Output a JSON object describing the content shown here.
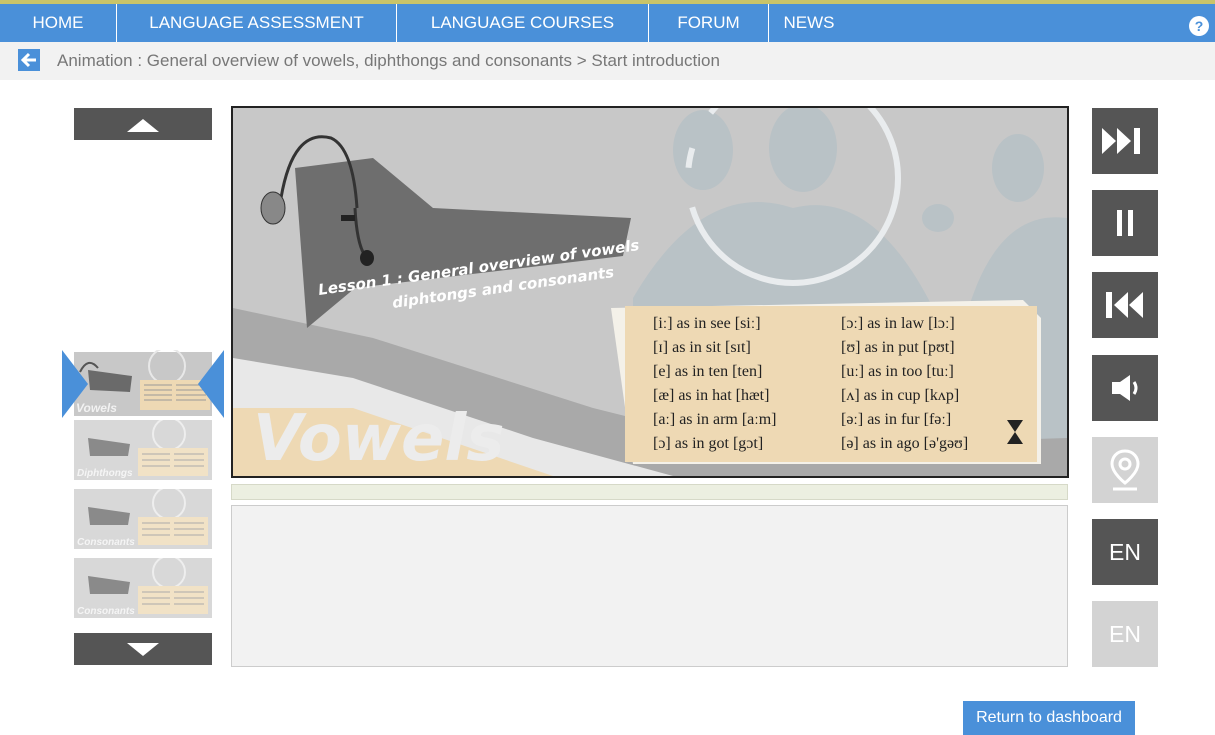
{
  "nav": {
    "items": [
      "HOME",
      "LANGUAGE ASSESSMENT",
      "LANGUAGE COURSES",
      "FORUM",
      "NEWS"
    ],
    "help_label": "?"
  },
  "breadcrumb": {
    "text": "Animation : General overview of vowels, diphthongs and consonants > Start introduction"
  },
  "thumbnails": [
    {
      "label": "Vowels",
      "active": true
    },
    {
      "label": "Diphthongs",
      "active": false
    },
    {
      "label": "Consonants",
      "active": false
    },
    {
      "label": "Consonants",
      "active": false
    }
  ],
  "slide": {
    "lesson_title_line1": "Lesson 1 : General overview of vowels",
    "lesson_title_line2": "diphtongs and consonants",
    "big_word": "Vowels",
    "phonetics_left": [
      "[iː] as in see [siː]",
      "[ɪ] as in sit [sɪt]",
      "[e] as in ten [ten]",
      "[æ] as in hat [hæt]",
      "[aː] as in arm [aːm]",
      "[ɔ] as in got [gɔt]"
    ],
    "phonetics_right": [
      "[ɔː] as in law [lɔː]",
      "[ʊ] as in put [pʊt]",
      "[uː] as in too [tuː]",
      "[ʌ] as in cup [kʌp]",
      "[əː] as in fur [fəː]",
      "[ə] as in ago [ə'gəʊ]"
    ]
  },
  "controls": {
    "skip_icon": "skip-forward-icon",
    "pause_icon": "pause-icon",
    "rewind_icon": "rewind-to-start-icon",
    "volume_icon": "speaker-icon",
    "location_icon": "location-pin-icon",
    "lang_primary": "EN",
    "lang_secondary": "EN"
  },
  "footer": {
    "return_label": "Return to dashboard"
  },
  "colors": {
    "accent": "#4a90d9",
    "control_dark": "#555555",
    "control_light": "#d3d3d3",
    "slide_bg": "#c8c8c8",
    "card_bg": "#eed9b4"
  }
}
